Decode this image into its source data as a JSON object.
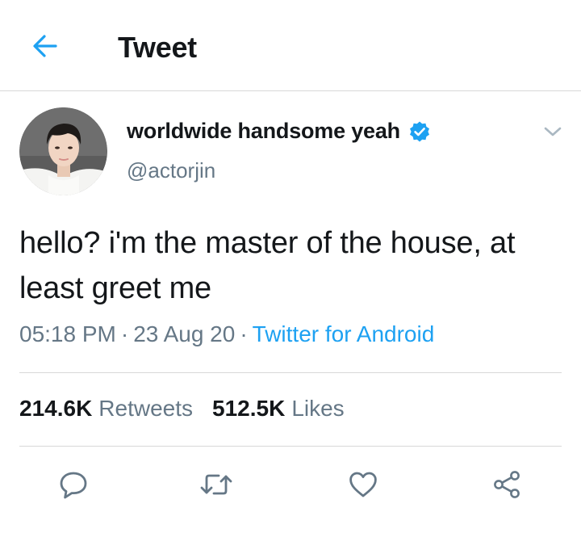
{
  "header": {
    "title": "Tweet",
    "back_icon": "arrow-left-icon"
  },
  "author": {
    "display_name": "worldwide handsome yeah",
    "handle": "@actorjin",
    "verified": true,
    "verified_icon": "verified-badge-icon",
    "avatar": "profile-photo"
  },
  "tweet": {
    "text": "hello? i'm the master of the house, at least greet me",
    "time": "05:18 PM",
    "separator": "·",
    "date": "23 Aug 20",
    "source": "Twitter for Android"
  },
  "stats": {
    "retweets_count": "214.6K",
    "retweets_label": "Retweets",
    "likes_count": "512.5K",
    "likes_label": "Likes"
  },
  "actions": [
    {
      "name": "reply",
      "icon": "reply-icon"
    },
    {
      "name": "retweet",
      "icon": "retweet-icon"
    },
    {
      "name": "like",
      "icon": "heart-icon"
    },
    {
      "name": "share",
      "icon": "share-icon"
    }
  ],
  "colors": {
    "accent": "#1da1f2",
    "secondary_text": "#657786",
    "primary_text": "#14171a",
    "divider": "#d8d8d8"
  }
}
